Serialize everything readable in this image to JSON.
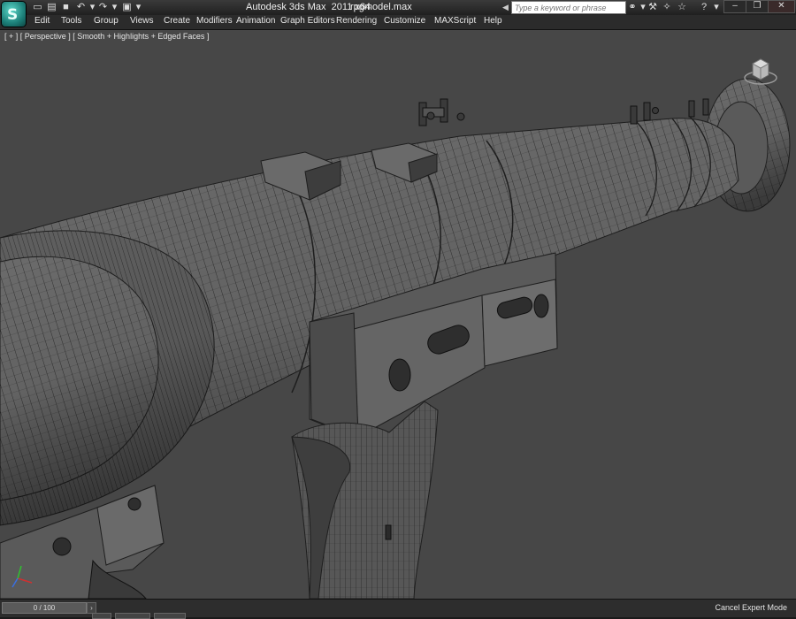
{
  "window": {
    "app_title": "Autodesk 3ds Max  2011 x64",
    "file_name": "rpgmodel.max",
    "logo_glyph": "S"
  },
  "quick_access": [
    "new-file",
    "open-file",
    "save-file",
    "undo",
    "redo",
    "project-folder",
    "dropdown"
  ],
  "search": {
    "placeholder": "Type a keyword or phrase"
  },
  "toolbar_icons": [
    "binoculars-icon",
    "star-icon",
    "wrench-icon",
    "star-sparkle-icon",
    "help-icon"
  ],
  "menu": {
    "items": [
      "Edit",
      "Tools",
      "Group",
      "Views",
      "Create",
      "Modifiers",
      "Animation",
      "Graph Editors",
      "Rendering",
      "Customize",
      "MAXScript",
      "Help"
    ]
  },
  "viewport": {
    "label": "[ + ] [ Perspective ] [ Smooth + Highlights + Edged Faces ]",
    "background": "#474747",
    "mesh_color": "#6e6e6e",
    "edge_color": "#1e1e1e"
  },
  "status": {
    "time_slider": "0 / 100",
    "mode": "Cancel Expert Mode"
  }
}
